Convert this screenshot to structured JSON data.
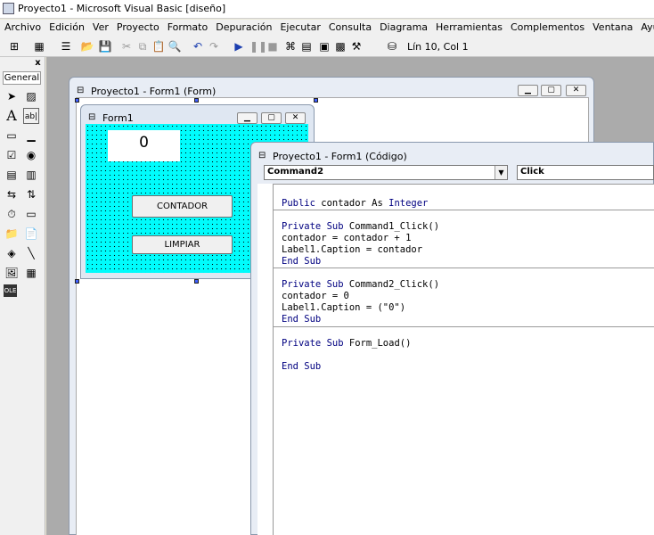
{
  "window": {
    "title": "Proyecto1 - Microsoft Visual Basic [diseño]"
  },
  "menu": [
    "Archivo",
    "Edición",
    "Ver",
    "Proyecto",
    "Formato",
    "Depuración",
    "Ejecutar",
    "Consulta",
    "Diagrama",
    "Herramientas",
    "Complementos",
    "Ventana",
    "Ayuda"
  ],
  "toolbar": {
    "status": "Lín 10, Col 1"
  },
  "toolbox": {
    "tab": "General",
    "close": "x"
  },
  "designer": {
    "title": "Proyecto1 - Form1 (Form)"
  },
  "form1": {
    "title": "Form1",
    "label1": "0",
    "button1": "CONTADOR",
    "button2": "LIMPIAR"
  },
  "codewindow": {
    "title": "Proyecto1 - Form1 (Código)",
    "object_combo": "Command2",
    "proc_combo": "Click",
    "lines": [
      {
        "kw": "Public",
        "rest": " contador As ",
        "kw2": "Integer"
      },
      {
        "kw": "Private Sub",
        "rest": " Command1_Click()"
      },
      {
        "kw": "",
        "rest": "contador = contador + 1"
      },
      {
        "kw": "",
        "rest": "Label1.Caption = contador"
      },
      {
        "kw": "End Sub",
        "rest": ""
      },
      {
        "kw": "Private Sub",
        "rest": " Command2_Click()"
      },
      {
        "kw": "",
        "rest": "contador = 0"
      },
      {
        "kw": "",
        "rest": "Label1.Caption = (\"0\")"
      },
      {
        "kw": "End Sub",
        "rest": ""
      },
      {
        "kw": "Private Sub",
        "rest": " Form_Load()"
      },
      {
        "kw": "End Sub",
        "rest": ""
      }
    ]
  },
  "colors": {
    "form_back": "#00fcfc",
    "keyword": "#000080"
  }
}
